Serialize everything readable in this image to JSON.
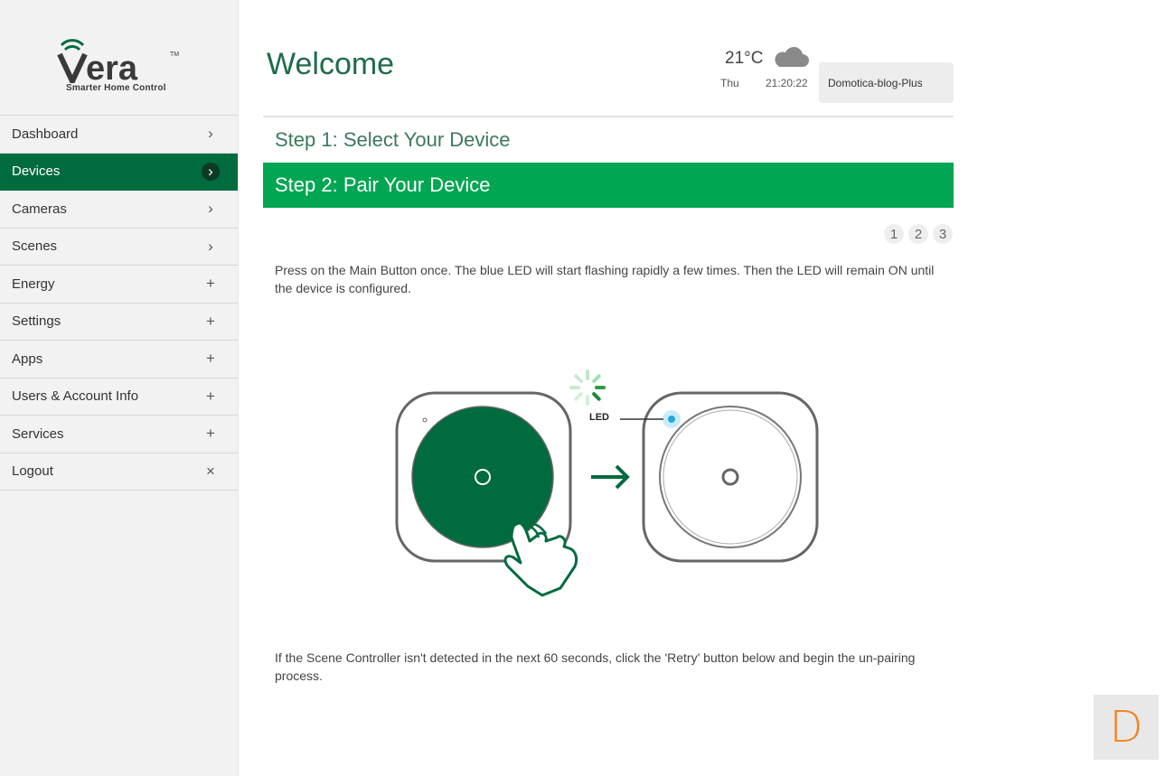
{
  "brand": {
    "logo_text": "Vera",
    "trademark": "TM",
    "tagline": "Smarter Home Control"
  },
  "sidebar": {
    "items": [
      {
        "label": "Dashboard",
        "icon": "chevron-right-icon",
        "glyph": "›"
      },
      {
        "label": "Devices",
        "icon": "chevron-right-icon",
        "glyph": "›",
        "active": true
      },
      {
        "label": "Cameras",
        "icon": "chevron-right-icon",
        "glyph": "›"
      },
      {
        "label": "Scenes",
        "icon": "chevron-right-icon",
        "glyph": "›"
      },
      {
        "label": "Energy",
        "icon": "plus-icon",
        "glyph": "+"
      },
      {
        "label": "Settings",
        "icon": "plus-icon",
        "glyph": "+"
      },
      {
        "label": "Apps",
        "icon": "plus-icon",
        "glyph": "+"
      },
      {
        "label": "Users & Account Info",
        "icon": "plus-icon",
        "glyph": "+"
      },
      {
        "label": "Services",
        "icon": "plus-icon",
        "glyph": "+"
      },
      {
        "label": "Logout",
        "icon": "close-icon",
        "glyph": "×"
      }
    ]
  },
  "header": {
    "title": "Welcome",
    "weather": {
      "temp": "21°C",
      "day": "Thu",
      "time": "21:20:22",
      "icon": "cloud-icon"
    },
    "account": "Domotica-blog-Plus"
  },
  "wizard": {
    "step1": "Step 1: Select Your Device",
    "step2": "Step 2: Pair Your Device",
    "pages": [
      "1",
      "2",
      "3"
    ],
    "instructions": "Press on the Main Button once. The blue LED will start flashing rapidly a few times. Then the LED will remain ON until the device is configured.",
    "led_label": "LED",
    "footer": "If the Scene Controller isn't detected in the next 60 seconds, click the 'Retry' button below and begin the un-pairing process."
  },
  "badge": {
    "letter": "D"
  },
  "colors": {
    "brand_green": "#006b3f",
    "step_green": "#00a651",
    "accent_orange": "#f58220"
  }
}
